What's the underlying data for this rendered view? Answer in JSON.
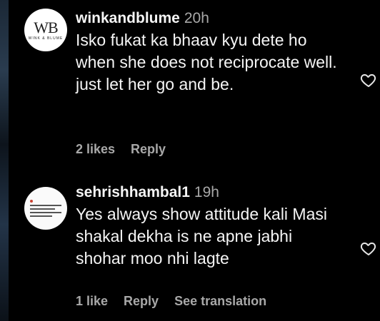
{
  "comments": [
    {
      "avatar_text": "WB",
      "avatar_subtext": "WINK & BLUME",
      "username": "winkandblume",
      "time": "20h",
      "text": "Isko fukat ka bhaav kyu dete ho when she does not reciprocate well. just let her go and be.",
      "likes": "2 likes",
      "reply": "Reply"
    },
    {
      "username": "sehrishhambal1",
      "time": "19h",
      "text": "Yes always show attitude kali Masi shakal dekha is ne apne jabhi shohar moo nhi lagte",
      "likes": "1 like",
      "reply": "Reply",
      "see_translation": "See translation"
    }
  ],
  "icons": {
    "like": "heart-outline-icon"
  },
  "colors": {
    "background": "#000000",
    "primary_text": "#f5f5f5",
    "secondary_text": "#a8a8a8"
  }
}
